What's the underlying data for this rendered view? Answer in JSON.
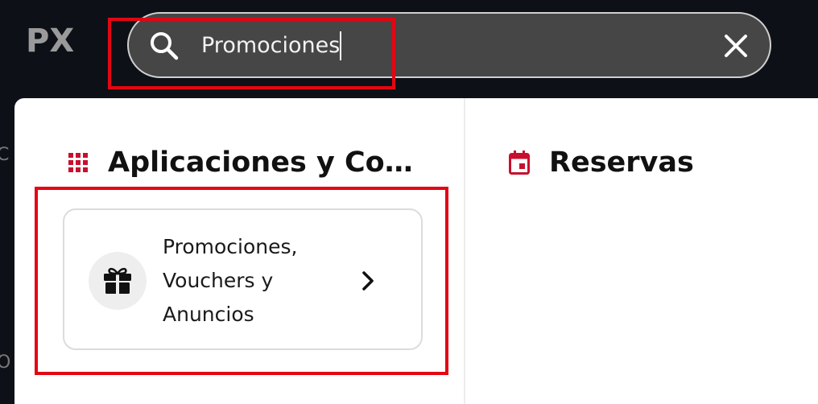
{
  "app": {
    "logo_text": "PX"
  },
  "search": {
    "value": "Promociones",
    "clear_icon": "close-icon",
    "search_icon": "search-icon"
  },
  "background": {
    "edge_letters": [
      "C",
      "O"
    ]
  },
  "sections": [
    {
      "title": "Aplicaciones y Configuración",
      "icon": "grid-icon",
      "icon_color": "#c8102e",
      "results": [
        {
          "label": "Promociones, Vouchers y Anuncios",
          "icon": "gift-icon"
        }
      ]
    },
    {
      "title": "Reservas",
      "icon": "calendar-icon",
      "icon_color": "#c8102e",
      "results": []
    }
  ],
  "colors": {
    "accent": "#c8102e",
    "annotation": "#e30613",
    "topbar": "#0d1117",
    "searchbar": "#464646"
  }
}
